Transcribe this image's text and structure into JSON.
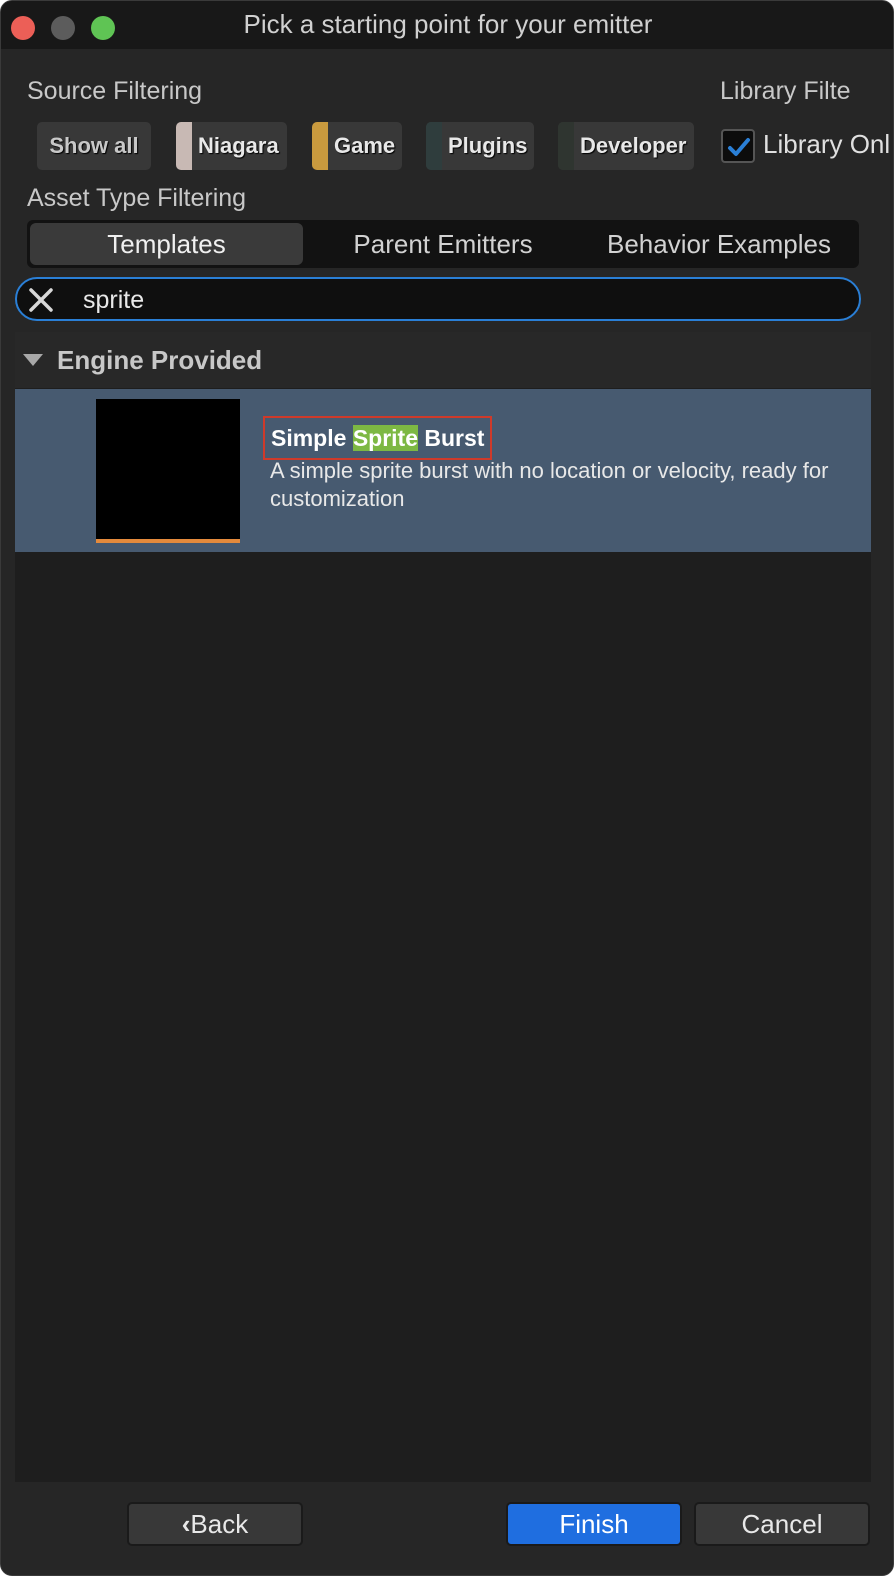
{
  "window": {
    "title": "Pick a starting point for your emitter"
  },
  "source_filtering": {
    "label": "Source Filtering",
    "buttons": [
      {
        "label": "Show all",
        "color": ""
      },
      {
        "label": "Niagara",
        "color": "#c8b9b4"
      },
      {
        "label": "Game",
        "color": "#c99a3e"
      },
      {
        "label": "Plugins",
        "color": "#2f3d3d"
      },
      {
        "label": "Developer",
        "color": "#2f3530"
      }
    ]
  },
  "library_filtering": {
    "label": "Library Filte",
    "checkbox_label": "Library Onl",
    "checked": true
  },
  "asset_type_filtering": {
    "label": "Asset Type Filtering",
    "tabs": [
      "Templates",
      "Parent Emitters",
      "Behavior Examples"
    ],
    "active_tab": "Templates"
  },
  "search": {
    "value": "sprite"
  },
  "results": {
    "group_label": "Engine Provided",
    "item": {
      "title_before": "Simple ",
      "title_match": "Sprite",
      "title_after": " Burst",
      "description": "A simple sprite burst with no location or velocity, ready for customization"
    }
  },
  "footer": {
    "back_label": "Back",
    "finish_label": "Finish",
    "cancel_label": "Cancel"
  },
  "colors": {
    "accent": "#1f6ee0",
    "search_border": "#2a7fd6",
    "selection": "#475a70",
    "match_highlight": "#7db843",
    "focus_box": "#cf3a2a"
  }
}
